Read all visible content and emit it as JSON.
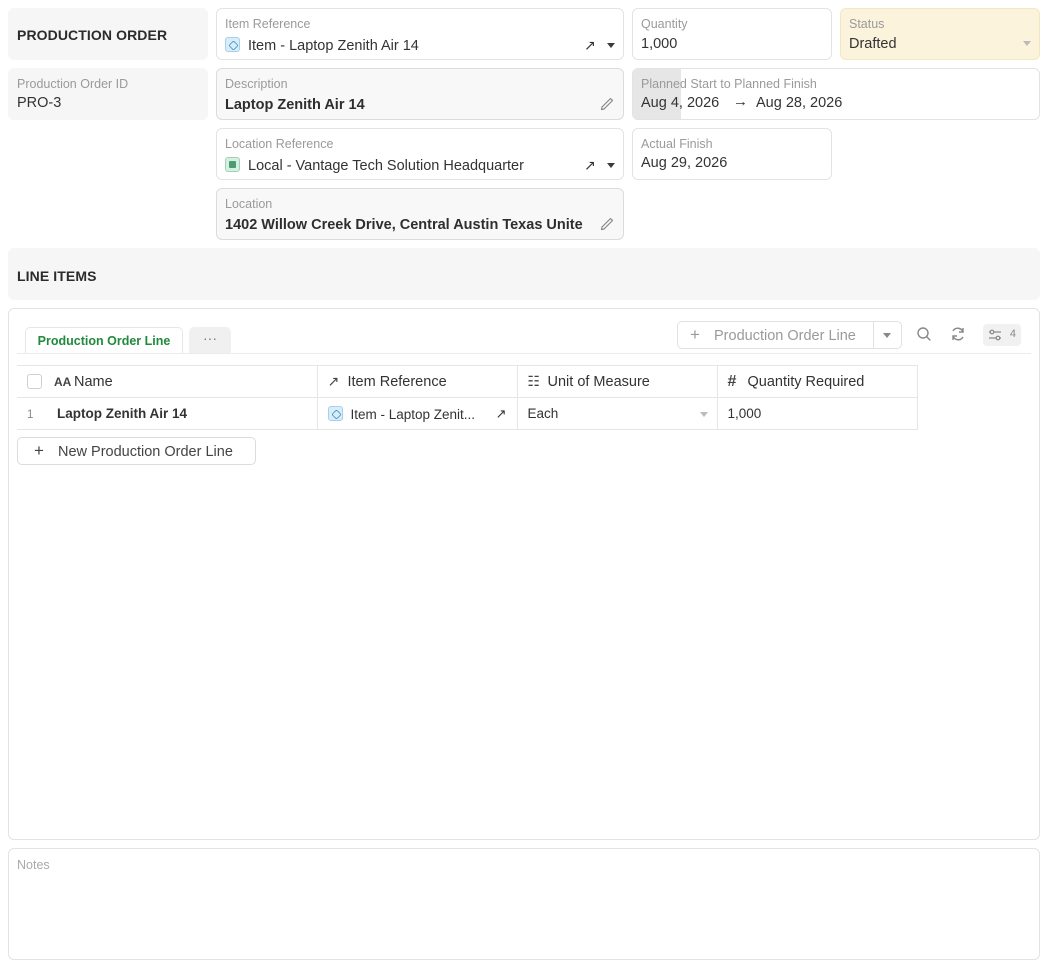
{
  "header": {
    "title": "PRODUCTION ORDER"
  },
  "fields": {
    "item_reference": {
      "label": "Item Reference",
      "value": "Item - Laptop Zenith Air 14"
    },
    "quantity": {
      "label": "Quantity",
      "value": "1,000"
    },
    "status": {
      "label": "Status",
      "value": "Drafted"
    },
    "production_order_id": {
      "label": "Production Order ID",
      "value": "PRO-3"
    },
    "description": {
      "label": "Description",
      "value": "Laptop Zenith Air 14"
    },
    "planned": {
      "label": "Planned Start to Planned Finish",
      "start": "Aug 4, 2026",
      "end": "Aug 28, 2026"
    },
    "location_reference": {
      "label": "Location Reference",
      "value": "Local - Vantage Tech Solution Headquarter"
    },
    "actual_finish": {
      "label": "Actual Finish",
      "value": "Aug 29, 2026"
    },
    "location": {
      "label": "Location",
      "value": "1402 Willow Creek Drive, Central  Austin Texas Unite"
    }
  },
  "line_items": {
    "title": "LINE ITEMS",
    "tabs": [
      {
        "label": "Production Order Line",
        "active": true
      },
      {
        "label": "···",
        "active": false
      }
    ],
    "toolbar": {
      "add_label": "Production Order Line",
      "filter_count": "4"
    },
    "columns": [
      {
        "icon": "text-type-icon",
        "glyph": "AA",
        "label": "Name"
      },
      {
        "icon": "arrow-up-right-icon",
        "glyph": "↗",
        "label": "Item Reference"
      },
      {
        "icon": "list-icon",
        "glyph": "☷",
        "label": "Unit of Measure"
      },
      {
        "icon": "hash-icon",
        "glyph": "#",
        "label": "Quantity Required"
      }
    ],
    "rows": [
      {
        "index": "1",
        "name": "Laptop Zenith Air 14",
        "item_reference": "Item - Laptop Zenit...",
        "unit_of_measure": "Each",
        "quantity_required": "1,000"
      }
    ],
    "new_line_label": "New Production Order Line"
  },
  "notes": {
    "label": "Notes"
  }
}
